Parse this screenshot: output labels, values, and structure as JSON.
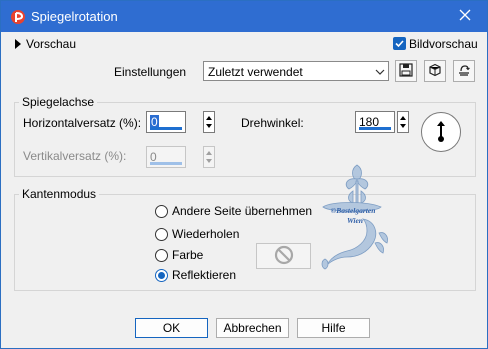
{
  "window": {
    "title": "Spiegelrotation",
    "app_icon": "psp-icon",
    "close_icon": "close-icon"
  },
  "top": {
    "preview_label": "Vorschau",
    "bild_preview_label": "Bildvorschau",
    "bild_preview_checked": true,
    "settings_label": "Einstellungen",
    "settings_value": "Zuletzt verwendet",
    "icons": [
      "save-icon",
      "preset-icon",
      "reset-icon"
    ]
  },
  "mirror_axis": {
    "group_label": "Spiegelachse",
    "h_offset_label": "Horizontalversatz (%):",
    "h_offset_value": "0",
    "v_offset_label": "Vertikalversatz (%):",
    "v_offset_value": "0",
    "rotation_label": "Drehwinkel:",
    "rotation_value": "180"
  },
  "edge_mode": {
    "group_label": "Kantenmodus",
    "options": [
      {
        "label": "Andere Seite übernehmen",
        "selected": false
      },
      {
        "label": "Wiederholen",
        "selected": false
      },
      {
        "label": "Farbe",
        "selected": false
      },
      {
        "label": "Reflektieren",
        "selected": true
      }
    ]
  },
  "watermark": {
    "lines": [
      "©Bastelgarten",
      "Wien"
    ]
  },
  "buttons": {
    "ok": "OK",
    "cancel": "Abbrechen",
    "help": "Hilfe"
  },
  "colors": {
    "titlebar": "#2f6dd1",
    "accent": "#1565c0"
  }
}
